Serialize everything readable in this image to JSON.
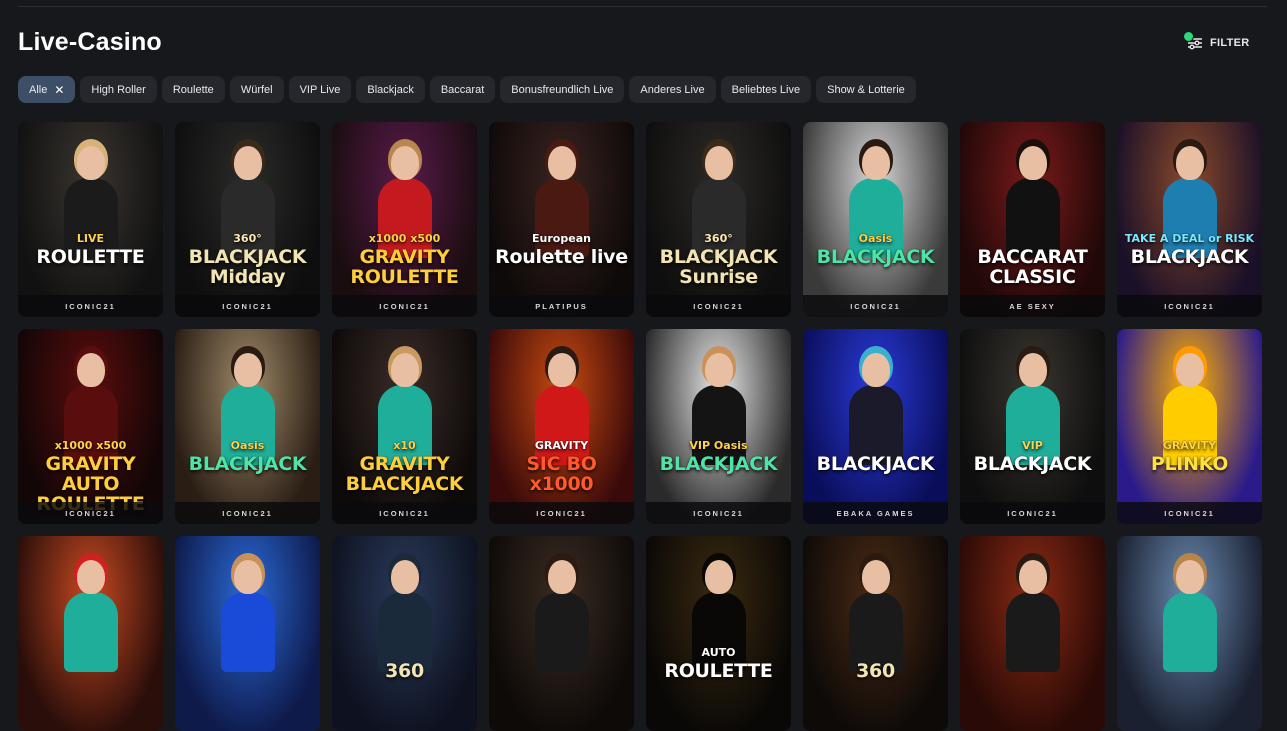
{
  "page": {
    "title": "Live-Casino"
  },
  "filter": {
    "label": "FILTER",
    "badge": "1"
  },
  "chips": [
    {
      "label": "Alle",
      "active": true
    },
    {
      "label": "High Roller"
    },
    {
      "label": "Roulette"
    },
    {
      "label": "Würfel"
    },
    {
      "label": "VIP Live"
    },
    {
      "label": "Blackjack"
    },
    {
      "label": "Baccarat"
    },
    {
      "label": "Bonusfreundlich Live"
    },
    {
      "label": "Anderes Live"
    },
    {
      "label": "Beliebtes Live"
    },
    {
      "label": "Show & Lotterie"
    }
  ],
  "games": [
    {
      "line1": "LIVE",
      "line2": "ROULETTE",
      "provider": "ICONIC21",
      "bg1": "#3a3530",
      "bg2": "#111",
      "dress": "#1b1b1b",
      "hair": "#d9b27a",
      "c1": "#ffd34a",
      "c2": "#ffffff"
    },
    {
      "line1": "360°",
      "line2": "BLACKJACK Midday",
      "provider": "ICONIC21",
      "bg1": "#2b2b2a",
      "bg2": "#0e0e0e",
      "dress": "#2a2a2a",
      "hair": "#3a2a1a",
      "c1": "#ffe9b0",
      "c2": "#f2e4b3"
    },
    {
      "line1": "x1000 x500",
      "line2": "GRAVITY ROULETTE",
      "provider": "ICONIC21",
      "bg1": "#5a1a4a",
      "bg2": "#1a0d10",
      "dress": "#c41a1f",
      "hair": "#b98650",
      "c1": "#ffd34a",
      "c2": "#ffce3a"
    },
    {
      "line1": "European",
      "line2": "Roulette live",
      "provider": "PLATIPUS",
      "bg1": "#3a2320",
      "bg2": "#0e0a09",
      "dress": "#4a1a12",
      "hair": "#4a1a12",
      "c1": "#ffffff",
      "c2": "#ffffff"
    },
    {
      "line1": "360°",
      "line2": "BLACKJACK Sunrise",
      "provider": "ICONIC21",
      "bg1": "#2d2a26",
      "bg2": "#0e0e0e",
      "dress": "#2a2a2a",
      "hair": "#3a2a1a",
      "c1": "#ffe9b0",
      "c2": "#f2e4b3"
    },
    {
      "line1": "Oasis",
      "line2": "BLACKJACK",
      "provider": "ICONIC21",
      "bg1": "#d8d8d8",
      "bg2": "#3a3a3a",
      "dress": "#1fae9a",
      "hair": "#2a1a12",
      "c1": "#ffd34a",
      "c2": "#4fe3a6"
    },
    {
      "line1": "",
      "line2": "BACCARAT CLASSIC",
      "provider": "AE SEXY",
      "bg1": "#7a1a1a",
      "bg2": "#200808",
      "dress": "#111111",
      "hair": "#1a0f0a",
      "c1": "#ffffff",
      "c2": "#ffffff"
    },
    {
      "line1": "TAKE A DEAL or RISK",
      "line2": "BLACKJACK",
      "provider": "ICONIC21",
      "bg1": "#8a4a2a",
      "bg2": "#1a1028",
      "dress": "#1f7eb0",
      "hair": "#2a1a12",
      "c1": "#7ae8ff",
      "c2": "#ffffff"
    },
    {
      "line1": "x1000 x500",
      "line2": "GRAVITY AUTO ROULETTE",
      "provider": "ICONIC21",
      "bg1": "#5a0d0d",
      "bg2": "#120606",
      "dress": "#5a0d0d",
      "hair": "#5a0d0d",
      "c1": "#ffd34a",
      "c2": "#ffce3a"
    },
    {
      "line1": "Oasis",
      "line2": "BLACKJACK",
      "provider": "ICONIC21",
      "bg1": "#a08a6a",
      "bg2": "#2a1e14",
      "dress": "#1fae9a",
      "hair": "#2a1a12",
      "c1": "#ffd34a",
      "c2": "#4fe3a6"
    },
    {
      "line1": "x10",
      "line2": "GRAVITY BLACKJACK",
      "provider": "ICONIC21",
      "bg1": "#3a2c28",
      "bg2": "#0e0a09",
      "dress": "#1fae9a",
      "hair": "#c89a60",
      "c1": "#ffd34a",
      "c2": "#ffce3a"
    },
    {
      "line1": "GRAVITY",
      "line2": "SIC BO x1000",
      "provider": "ICONIC21",
      "bg1": "#c84a10",
      "bg2": "#3a0a0a",
      "dress": "#d01818",
      "hair": "#2a1a12",
      "c1": "#ffffff",
      "c2": "#ff5a2a"
    },
    {
      "line1": "VIP Oasis",
      "line2": "BLACKJACK",
      "provider": "ICONIC21",
      "bg1": "#e8e8e8",
      "bg2": "#2a2a2a",
      "dress": "#141414",
      "hair": "#c8925a",
      "c1": "#ffd34a",
      "c2": "#4fe3a6"
    },
    {
      "line1": "",
      "line2": "BLACKJACK",
      "provider": "EBAKA GAMES",
      "bg1": "#2a3ad8",
      "bg2": "#0a0e5a",
      "dress": "#1a1a2a",
      "hair": "#3ab0d0",
      "c1": "#ffffff",
      "c2": "#ffffff"
    },
    {
      "line1": "VIP",
      "line2": "BLACKJACK",
      "provider": "ICONIC21",
      "bg1": "#3a3630",
      "bg2": "#0e0e0e",
      "dress": "#1fae9a",
      "hair": "#2a1a12",
      "c1": "#ffd34a",
      "c2": "#ffffff"
    },
    {
      "line1": "GRAVITY",
      "line2": "PLINKO",
      "provider": "ICONIC21",
      "bg1": "#ffb000",
      "bg2": "#2a1a8a",
      "dress": "#ffcc00",
      "hair": "#ff9a00",
      "c1": "#ffd34a",
      "c2": "#ffe040"
    },
    {
      "line1": "",
      "line2": "",
      "provider": "",
      "bg1": "#c84a20",
      "bg2": "#2a0e0a",
      "dress": "#1fae9a",
      "hair": "#d02020",
      "c1": "#fff",
      "c2": "#fff"
    },
    {
      "line1": "",
      "line2": "",
      "provider": "",
      "bg1": "#2a6ad8",
      "bg2": "#0e1a4a",
      "dress": "#1a4ad8",
      "hair": "#c8925a",
      "c1": "#fff",
      "c2": "#fff"
    },
    {
      "line1": "",
      "line2": "360",
      "provider": "",
      "bg1": "#2a3a5a",
      "bg2": "#0e1220",
      "dress": "#1a2a3a",
      "hair": "#1a2a3a",
      "c1": "#fff",
      "c2": "#f2e4b3"
    },
    {
      "line1": "",
      "line2": "",
      "provider": "",
      "bg1": "#3a2c22",
      "bg2": "#0e0a08",
      "dress": "#1a1a1a",
      "hair": "#2a1a12",
      "c1": "#fff",
      "c2": "#fff"
    },
    {
      "line1": "AUTO",
      "line2": "ROULETTE",
      "provider": "",
      "bg1": "#3a2a10",
      "bg2": "#0a0806",
      "dress": "#0a0806",
      "hair": "#0a0806",
      "c1": "#ffffff",
      "c2": "#ffffff"
    },
    {
      "line1": "",
      "line2": "360",
      "provider": "",
      "bg1": "#4a2a14",
      "bg2": "#0e0a08",
      "dress": "#1a1a1a",
      "hair": "#2a1a12",
      "c1": "#fff",
      "c2": "#f2e4b3"
    },
    {
      "line1": "",
      "line2": "",
      "provider": "",
      "bg1": "#8a2a14",
      "bg2": "#2a0a06",
      "dress": "#1a1a1a",
      "hair": "#2a1a12",
      "c1": "#fff",
      "c2": "#fff"
    },
    {
      "line1": "",
      "line2": "",
      "provider": "",
      "bg1": "#6a8ab0",
      "bg2": "#1a2030",
      "dress": "#1fae9a",
      "hair": "#b8864a",
      "c1": "#fff",
      "c2": "#fff"
    }
  ]
}
